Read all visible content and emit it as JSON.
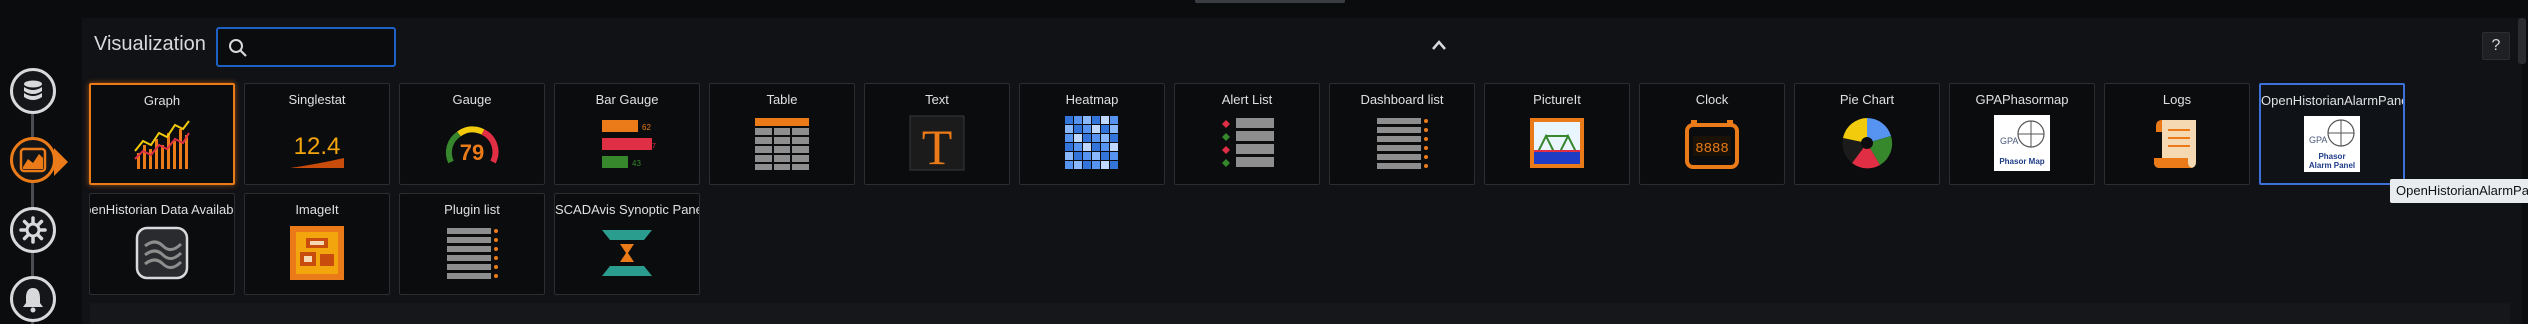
{
  "header": {
    "title": "Visualization",
    "search_placeholder": "",
    "help_label": "?"
  },
  "tooltip": "OpenHistorianAlarmPanel",
  "rail": [
    "database-icon",
    "chart-area-icon",
    "gear-icon",
    "bell-icon"
  ],
  "colors": {
    "accent": "#eb7b18",
    "focus": "#1f60c4",
    "hover": "#3d71d9"
  },
  "visualizations": [
    {
      "name": "Graph",
      "icon": "graph-icon",
      "state": "current"
    },
    {
      "name": "Singlestat",
      "icon": "singlestat-icon",
      "value": "12.4"
    },
    {
      "name": "Gauge",
      "icon": "gauge-icon",
      "value": "79"
    },
    {
      "name": "Bar Gauge",
      "icon": "bar-gauge-icon",
      "values": [
        "62",
        "71",
        "43"
      ]
    },
    {
      "name": "Table",
      "icon": "table-icon"
    },
    {
      "name": "Text",
      "icon": "text-icon",
      "glyph": "T"
    },
    {
      "name": "Heatmap",
      "icon": "heatmap-icon"
    },
    {
      "name": "Alert List",
      "icon": "alert-list-icon"
    },
    {
      "name": "Dashboard list",
      "icon": "dashboard-list-icon"
    },
    {
      "name": "PictureIt",
      "icon": "pictureit-icon"
    },
    {
      "name": "Clock",
      "icon": "clock-icon",
      "display": "8888"
    },
    {
      "name": "Pie Chart",
      "icon": "pie-chart-icon"
    },
    {
      "name": "GPAPhasormap",
      "icon": "gpa-phasormap-icon",
      "logo_text": [
        "GPA",
        "Phasor Map"
      ]
    },
    {
      "name": "Logs",
      "icon": "logs-icon"
    },
    {
      "name": "OpenHistorianAlarmPanel",
      "icon": "alarm-panel-icon",
      "state": "hovered",
      "logo_text": [
        "GPA",
        "Phasor",
        "Alarm Panel"
      ]
    },
    {
      "name": "OpenHistorian Data Availability Chart",
      "icon": "data-availability-icon"
    },
    {
      "name": "ImageIt",
      "icon": "imageit-icon"
    },
    {
      "name": "Plugin list",
      "icon": "plugin-list-icon"
    },
    {
      "name": "SCADAvis Synoptic Panel",
      "icon": "scadavis-icon"
    }
  ]
}
